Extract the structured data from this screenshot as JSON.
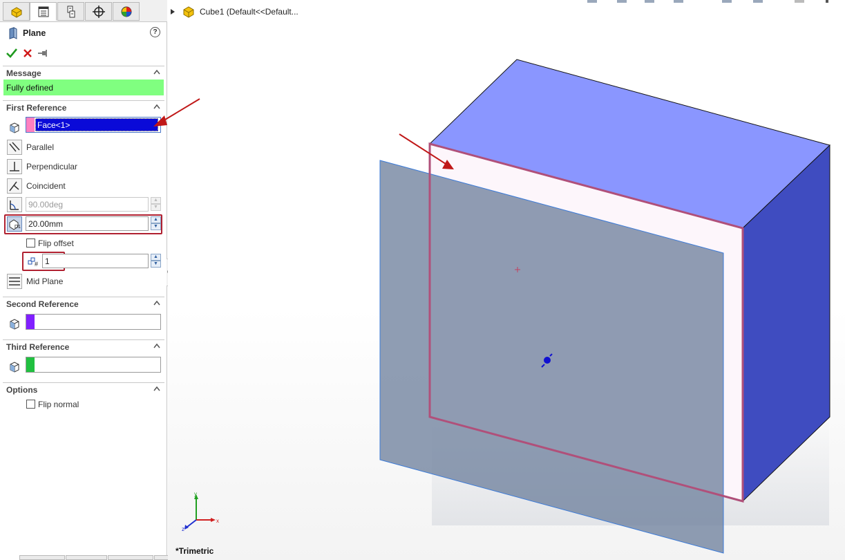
{
  "property_manager": {
    "tabs": [
      "feature-manager",
      "property-manager",
      "configuration-manager",
      "dimxpert-manager",
      "display-manager"
    ],
    "title": "Plane",
    "help_symbol": "?",
    "message": {
      "header": "Message",
      "text": "Fully defined",
      "color": "#80ff80"
    },
    "first_reference": {
      "header": "First Reference",
      "selection": "Face<1>",
      "swatch_color": "#ff80c0",
      "options": {
        "parallel": "Parallel",
        "perpendicular": "Perpendicular",
        "coincident": "Coincident",
        "angle_value": "90.00deg",
        "offset_value": "20.00mm",
        "flip_offset": "Flip offset",
        "instances_value": "1",
        "mid_plane": "Mid Plane"
      }
    },
    "second_reference": {
      "header": "Second Reference",
      "swatch_color": "#8020ff"
    },
    "third_reference": {
      "header": "Third Reference",
      "swatch_color": "#20c040"
    },
    "options": {
      "header": "Options",
      "flip_normal": "Flip normal"
    }
  },
  "graphics": {
    "tree_label": "Cube1  (Default<<Default...",
    "view_label": "*Trimetric",
    "triad": {
      "x": "x",
      "y": "y",
      "z": "z"
    },
    "colors": {
      "top_face": "#8a96ff",
      "right_face": "#3f4cc0",
      "selected_face": "#fdf6fb",
      "face_outline": "#b0507a",
      "plane_fill": "#6f829e",
      "annotation_arrow": "#c01818"
    }
  }
}
